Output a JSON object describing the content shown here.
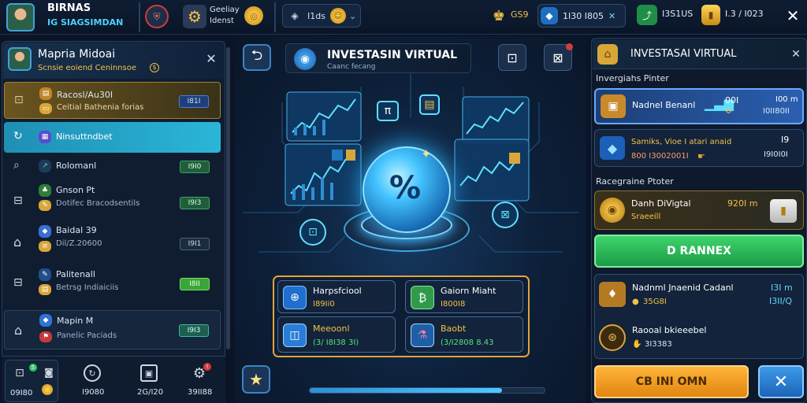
{
  "topbar": {
    "player_name": "BIRNAS",
    "player_sub": "IG SIAGSIMDAN",
    "coin_label_1": "Geeliay",
    "coin_label_2": "Idenst",
    "filter_value": "I1ds",
    "stat_1": "GS9",
    "stat_2": "1I30 I805",
    "stat_3": "I3S1US",
    "stat_4": "I.3 / I023"
  },
  "left_panel": {
    "header_title": "Mapria Midoai",
    "header_sub": "Scnsie eoiend Ceninnsoe",
    "items": [
      {
        "title": "Racosl/Au30I",
        "sub": "Ceitial Bathenia forias",
        "value": "I81I"
      },
      {
        "title": "Ninsuttndbet",
        "sub": "",
        "value": ""
      },
      {
        "title": "Rolomanl",
        "sub": "",
        "value": "I9I0"
      },
      {
        "title": "Gnson Pt",
        "sub": "Dotifec Bracodsentils",
        "value": "I9I3"
      },
      {
        "title": "Baidal 39",
        "sub": "Dil/Z.20600",
        "value": "I9I1"
      },
      {
        "title": "Palitenall",
        "sub": "Betrsg Indiaiciis",
        "value": "I8II"
      },
      {
        "title": "Mapin M",
        "sub": "Panelic Paciads",
        "value": "I9I3"
      }
    ],
    "bottom_stats": [
      "09I80",
      "I9080",
      "2G/I20",
      "39II88"
    ]
  },
  "center": {
    "title": "INVESTASIN VIRTUAL",
    "subtitle": "Caanc fecang",
    "symbol": "%",
    "hud_1": "π",
    "boxes": [
      {
        "title": "Harpsfciool",
        "value": "I89Ii0"
      },
      {
        "title": "Gaiorn Miaht",
        "value": "I800I8"
      },
      {
        "title": "Meeoonl",
        "value": "(3/ I8I38 3I)"
      },
      {
        "title": "Baobt",
        "value": "(3/I2808 8.43"
      }
    ]
  },
  "right_panel": {
    "header_title": "INVESTASAI VIRTUAL",
    "section_1": "Invergiahs Pinter",
    "card_1": {
      "title": "Nadnel Benanl",
      "value": "00I",
      "sub_value": "I00 m",
      "sub_value_2": "I0II80II"
    },
    "card_2": {
      "title": "Samiks, Vioe I atari anaid",
      "sub": "800 I3002001I",
      "value": "I9",
      "sub_value": "I9I0I0I"
    },
    "section_2": "Racegraine Ptoter",
    "card_3": {
      "title": "Danh DiVigtal",
      "value": "920I m",
      "sub": "Sraeeill"
    },
    "green_button": "D RANNEX",
    "card_4": {
      "title": "Nadnml Jnaenid Cadanl",
      "value": "I3I m",
      "sub": "35G8I",
      "sub_value": "I3II/Q"
    },
    "card_5": {
      "title": "Raooal bkieeebel",
      "sub": "3I3383"
    },
    "confirm_button": "CB INI OMN"
  },
  "colors": {
    "accent_cyan": "#3fb9e6",
    "accent_green": "#2ec563",
    "accent_orange": "#f29a1c",
    "bg": "#0b1426"
  }
}
